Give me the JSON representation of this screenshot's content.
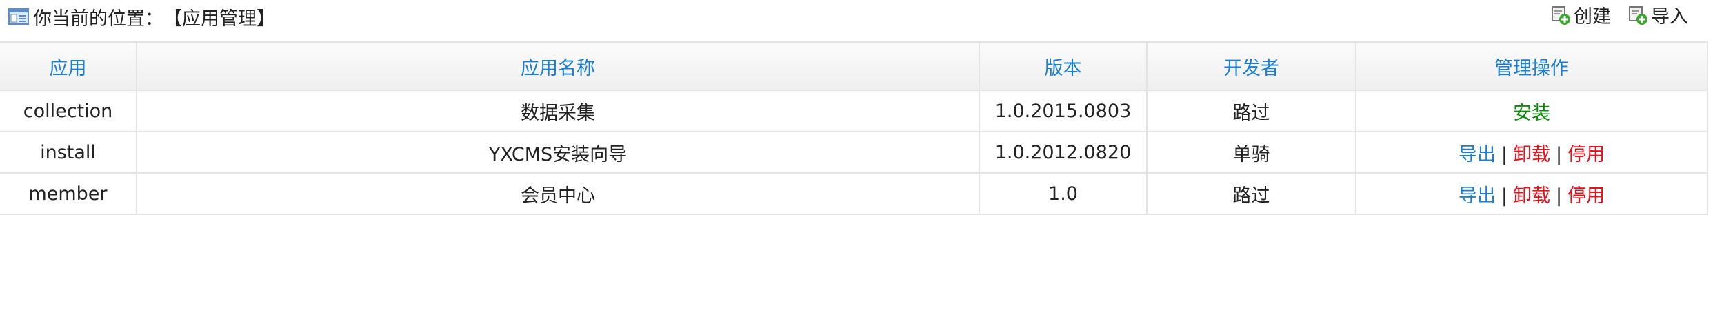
{
  "breadcrumb": {
    "prefix": "你当前的位置：",
    "current": "【应用管理】"
  },
  "toolbar": {
    "create_label": "创建",
    "import_label": "导入"
  },
  "table": {
    "headers": [
      "应用",
      "应用名称",
      "版本",
      "开发者",
      "管理操作"
    ],
    "rows": [
      {
        "app": "collection",
        "name": "数据采集",
        "version": "1.0.2015.0803",
        "developer": "路过",
        "install": "安装"
      },
      {
        "app": "install",
        "name": "YXCMS安装向导",
        "version": "1.0.2012.0820",
        "developer": "单骑",
        "export": "导出",
        "uninstall": "卸载",
        "disable": "停用",
        "separator": "|"
      },
      {
        "app": "member",
        "name": "会员中心",
        "version": "1.0",
        "developer": "路过",
        "export": "导出",
        "uninstall": "卸载",
        "disable": "停用",
        "separator": "|"
      }
    ]
  },
  "colors": {
    "header_text": "#1a7fd1",
    "install_green": "#0a8a0a",
    "action_red": "#e8101a",
    "border": "#e3e3e3"
  },
  "icons": {
    "location": "window-icon",
    "create": "add-document-icon",
    "import": "import-document-icon"
  }
}
